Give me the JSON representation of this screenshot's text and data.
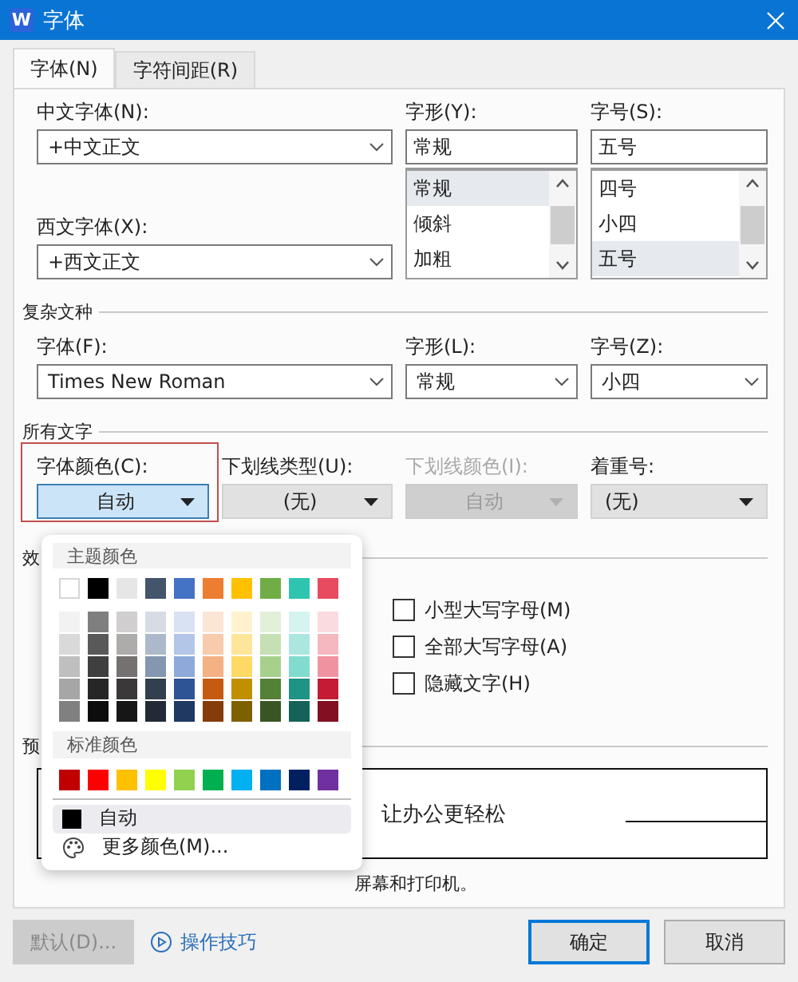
{
  "window": {
    "title": "字体",
    "app_icon": "W"
  },
  "tabs": [
    {
      "label": "字体(N)",
      "selected": true
    },
    {
      "label": "字符间距(R)",
      "selected": false
    }
  ],
  "chinese_font": {
    "label": "中文字体(N):",
    "value": "+中文正文"
  },
  "western_font": {
    "label": "西文字体(X):",
    "value": "+西文正文"
  },
  "style": {
    "label": "字形(Y):",
    "value": "常规",
    "options": [
      {
        "label": "常规",
        "selected": true
      },
      {
        "label": "倾斜",
        "selected": false
      },
      {
        "label": "加粗",
        "selected": false
      }
    ]
  },
  "size": {
    "label": "字号(S):",
    "value": "五号",
    "options": [
      {
        "label": "四号",
        "selected": false
      },
      {
        "label": "小四",
        "selected": false
      },
      {
        "label": "五号",
        "selected": true
      }
    ]
  },
  "complex_script": {
    "title": "复杂文种",
    "fields": [
      {
        "label": "字体(F):",
        "value": "Times New Roman"
      },
      {
        "label": "字形(L):",
        "value": "常规"
      },
      {
        "label": "字号(Z):",
        "value": "小四"
      }
    ]
  },
  "all_text": {
    "title": "所有文字",
    "fields": [
      {
        "label": "字体颜色(C):",
        "value": "自动",
        "disabled": false,
        "open": true,
        "highlighted": true
      },
      {
        "label": "下划线类型(U):",
        "value": "(无)",
        "disabled": false,
        "open": false,
        "highlighted": false
      },
      {
        "label": "下划线颜色(I):",
        "value": "自动",
        "disabled": true,
        "open": false,
        "highlighted": false
      },
      {
        "label": "着重号:",
        "value": "(无)",
        "disabled": false,
        "open": false,
        "highlighted": false
      }
    ]
  },
  "effects": {
    "title": "效",
    "checkboxes": [
      {
        "label": "小型大写字母(M)",
        "checked": false
      },
      {
        "label": "全部大写字母(A)",
        "checked": false
      },
      {
        "label": "隐藏文字(H)",
        "checked": false
      }
    ]
  },
  "preview": {
    "title": "预",
    "sample": "让办公更轻松",
    "note": "屏幕和打印机。"
  },
  "color_menu": {
    "theme_title": "主题颜色",
    "theme_colors": [
      {
        "color": "#ffffff"
      },
      {
        "color": "#000000"
      },
      {
        "color": "#e7e6e6"
      },
      {
        "color": "#44546a"
      },
      {
        "color": "#4472c4"
      },
      {
        "color": "#ed7d31"
      },
      {
        "color": "#ffc000"
      },
      {
        "color": "#70ad47"
      },
      {
        "color": "#2ec4b0"
      },
      {
        "color": "#e84a5f"
      }
    ],
    "shade_rows": [
      [
        {
          "color": "#f2f2f2"
        },
        {
          "color": "#7f7f7f"
        },
        {
          "color": "#d0cece"
        },
        {
          "color": "#d6dce4"
        },
        {
          "color": "#d9e2f3"
        },
        {
          "color": "#fbe5d5"
        },
        {
          "color": "#fff2cc"
        },
        {
          "color": "#e2efd9"
        },
        {
          "color": "#d5f3ef"
        },
        {
          "color": "#fadbe0"
        }
      ],
      [
        {
          "color": "#d9d9d9"
        },
        {
          "color": "#595959"
        },
        {
          "color": "#aeabab"
        },
        {
          "color": "#adb9ca"
        },
        {
          "color": "#b4c6e7"
        },
        {
          "color": "#f7cbac"
        },
        {
          "color": "#fee599"
        },
        {
          "color": "#c5e0b3"
        },
        {
          "color": "#abe7df"
        },
        {
          "color": "#f5b7c0"
        }
      ],
      [
        {
          "color": "#bfbfbf"
        },
        {
          "color": "#3f3f3f"
        },
        {
          "color": "#757171"
        },
        {
          "color": "#8496b0"
        },
        {
          "color": "#8eaadb"
        },
        {
          "color": "#f4b183"
        },
        {
          "color": "#ffd965"
        },
        {
          "color": "#a8d08d"
        },
        {
          "color": "#81dbcf"
        },
        {
          "color": "#f093a1"
        }
      ],
      [
        {
          "color": "#a6a6a6"
        },
        {
          "color": "#262626"
        },
        {
          "color": "#3a3838"
        },
        {
          "color": "#333f4f"
        },
        {
          "color": "#2f5496"
        },
        {
          "color": "#c55a11"
        },
        {
          "color": "#bf9000"
        },
        {
          "color": "#538135"
        },
        {
          "color": "#1f9384"
        },
        {
          "color": "#c51b34"
        }
      ],
      [
        {
          "color": "#808080"
        },
        {
          "color": "#0d0d0d"
        },
        {
          "color": "#171616"
        },
        {
          "color": "#222a35"
        },
        {
          "color": "#1f3864"
        },
        {
          "color": "#843c0b"
        },
        {
          "color": "#7f6000"
        },
        {
          "color": "#375623"
        },
        {
          "color": "#156258"
        },
        {
          "color": "#830f22"
        }
      ]
    ],
    "standard_title": "标准颜色",
    "standard_colors": [
      {
        "color": "#c00000"
      },
      {
        "color": "#ff0000"
      },
      {
        "color": "#ffc000"
      },
      {
        "color": "#ffff00"
      },
      {
        "color": "#92d050"
      },
      {
        "color": "#00b050"
      },
      {
        "color": "#00b0f0"
      },
      {
        "color": "#0070c0"
      },
      {
        "color": "#002060"
      },
      {
        "color": "#7030a0"
      }
    ],
    "auto": {
      "label": "自动",
      "selected": true
    },
    "more": {
      "label": "更多颜色(M)..."
    }
  },
  "buttons": {
    "default": {
      "label": "默认(D)...",
      "disabled": true
    },
    "tips": "操作技巧",
    "ok": {
      "label": "确定",
      "focused": true
    },
    "cancel": {
      "label": "取消"
    }
  }
}
